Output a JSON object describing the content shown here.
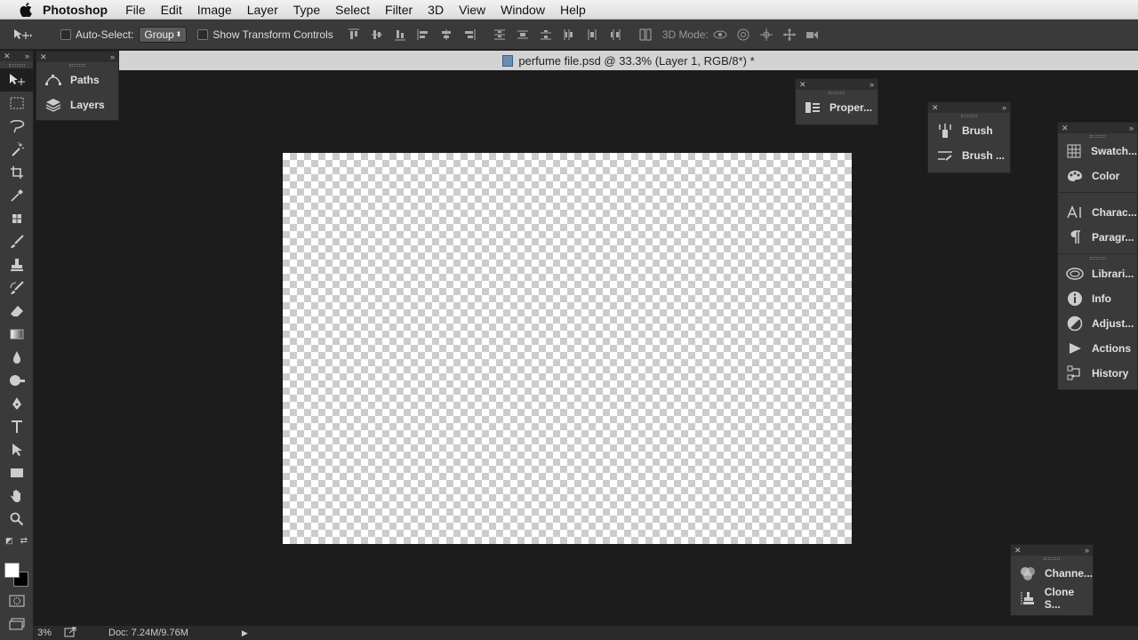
{
  "menubar": {
    "app_name": "Photoshop",
    "items": [
      "File",
      "Edit",
      "Image",
      "Layer",
      "Type",
      "Select",
      "Filter",
      "3D",
      "View",
      "Window",
      "Help"
    ]
  },
  "options": {
    "auto_select_label": "Auto-Select:",
    "auto_select_value": "Group",
    "transform_label": "Show Transform Controls",
    "mode_label": "3D Mode:"
  },
  "document": {
    "tab_title": "perfume file.psd @ 33.3% (Layer 1, RGB/8*) *"
  },
  "panels": {
    "left_group": [
      "Paths",
      "Layers"
    ],
    "properties": [
      "Proper..."
    ],
    "brush_group": [
      "Brush",
      "Brush ..."
    ],
    "right_dock_1": [
      "Swatch...",
      "Color"
    ],
    "right_dock_2": [
      "Charac...",
      "Paragr..."
    ],
    "right_dock_3": [
      "Librari...",
      "Info",
      "Adjust...",
      "Actions",
      "History"
    ],
    "bottom_group": [
      "Channe...",
      "Clone S..."
    ]
  },
  "status": {
    "zoom": "3%",
    "doc_info": "Doc: 7.24M/9.76M"
  },
  "colors": {
    "foreground": "#ffffff",
    "background": "#000000",
    "ui_dark": "#3a3a3a",
    "workspace": "#1c1c1c"
  }
}
